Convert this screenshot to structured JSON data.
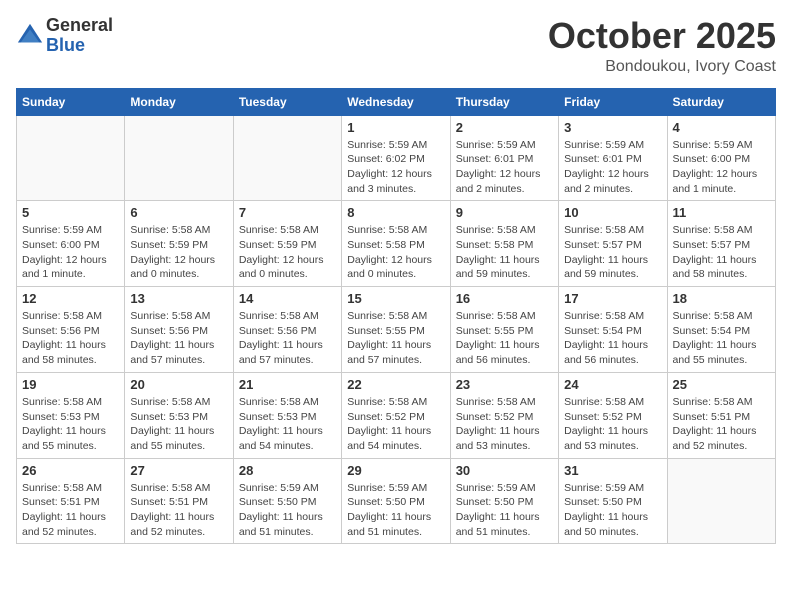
{
  "header": {
    "logo_general": "General",
    "logo_blue": "Blue",
    "month_title": "October 2025",
    "subtitle": "Bondoukou, Ivory Coast"
  },
  "days_of_week": [
    "Sunday",
    "Monday",
    "Tuesday",
    "Wednesday",
    "Thursday",
    "Friday",
    "Saturday"
  ],
  "weeks": [
    [
      {
        "day": "",
        "info": ""
      },
      {
        "day": "",
        "info": ""
      },
      {
        "day": "",
        "info": ""
      },
      {
        "day": "1",
        "info": "Sunrise: 5:59 AM\nSunset: 6:02 PM\nDaylight: 12 hours\nand 3 minutes."
      },
      {
        "day": "2",
        "info": "Sunrise: 5:59 AM\nSunset: 6:01 PM\nDaylight: 12 hours\nand 2 minutes."
      },
      {
        "day": "3",
        "info": "Sunrise: 5:59 AM\nSunset: 6:01 PM\nDaylight: 12 hours\nand 2 minutes."
      },
      {
        "day": "4",
        "info": "Sunrise: 5:59 AM\nSunset: 6:00 PM\nDaylight: 12 hours\nand 1 minute."
      }
    ],
    [
      {
        "day": "5",
        "info": "Sunrise: 5:59 AM\nSunset: 6:00 PM\nDaylight: 12 hours\nand 1 minute."
      },
      {
        "day": "6",
        "info": "Sunrise: 5:58 AM\nSunset: 5:59 PM\nDaylight: 12 hours\nand 0 minutes."
      },
      {
        "day": "7",
        "info": "Sunrise: 5:58 AM\nSunset: 5:59 PM\nDaylight: 12 hours\nand 0 minutes."
      },
      {
        "day": "8",
        "info": "Sunrise: 5:58 AM\nSunset: 5:58 PM\nDaylight: 12 hours\nand 0 minutes."
      },
      {
        "day": "9",
        "info": "Sunrise: 5:58 AM\nSunset: 5:58 PM\nDaylight: 11 hours\nand 59 minutes."
      },
      {
        "day": "10",
        "info": "Sunrise: 5:58 AM\nSunset: 5:57 PM\nDaylight: 11 hours\nand 59 minutes."
      },
      {
        "day": "11",
        "info": "Sunrise: 5:58 AM\nSunset: 5:57 PM\nDaylight: 11 hours\nand 58 minutes."
      }
    ],
    [
      {
        "day": "12",
        "info": "Sunrise: 5:58 AM\nSunset: 5:56 PM\nDaylight: 11 hours\nand 58 minutes."
      },
      {
        "day": "13",
        "info": "Sunrise: 5:58 AM\nSunset: 5:56 PM\nDaylight: 11 hours\nand 57 minutes."
      },
      {
        "day": "14",
        "info": "Sunrise: 5:58 AM\nSunset: 5:56 PM\nDaylight: 11 hours\nand 57 minutes."
      },
      {
        "day": "15",
        "info": "Sunrise: 5:58 AM\nSunset: 5:55 PM\nDaylight: 11 hours\nand 57 minutes."
      },
      {
        "day": "16",
        "info": "Sunrise: 5:58 AM\nSunset: 5:55 PM\nDaylight: 11 hours\nand 56 minutes."
      },
      {
        "day": "17",
        "info": "Sunrise: 5:58 AM\nSunset: 5:54 PM\nDaylight: 11 hours\nand 56 minutes."
      },
      {
        "day": "18",
        "info": "Sunrise: 5:58 AM\nSunset: 5:54 PM\nDaylight: 11 hours\nand 55 minutes."
      }
    ],
    [
      {
        "day": "19",
        "info": "Sunrise: 5:58 AM\nSunset: 5:53 PM\nDaylight: 11 hours\nand 55 minutes."
      },
      {
        "day": "20",
        "info": "Sunrise: 5:58 AM\nSunset: 5:53 PM\nDaylight: 11 hours\nand 55 minutes."
      },
      {
        "day": "21",
        "info": "Sunrise: 5:58 AM\nSunset: 5:53 PM\nDaylight: 11 hours\nand 54 minutes."
      },
      {
        "day": "22",
        "info": "Sunrise: 5:58 AM\nSunset: 5:52 PM\nDaylight: 11 hours\nand 54 minutes."
      },
      {
        "day": "23",
        "info": "Sunrise: 5:58 AM\nSunset: 5:52 PM\nDaylight: 11 hours\nand 53 minutes."
      },
      {
        "day": "24",
        "info": "Sunrise: 5:58 AM\nSunset: 5:52 PM\nDaylight: 11 hours\nand 53 minutes."
      },
      {
        "day": "25",
        "info": "Sunrise: 5:58 AM\nSunset: 5:51 PM\nDaylight: 11 hours\nand 52 minutes."
      }
    ],
    [
      {
        "day": "26",
        "info": "Sunrise: 5:58 AM\nSunset: 5:51 PM\nDaylight: 11 hours\nand 52 minutes."
      },
      {
        "day": "27",
        "info": "Sunrise: 5:58 AM\nSunset: 5:51 PM\nDaylight: 11 hours\nand 52 minutes."
      },
      {
        "day": "28",
        "info": "Sunrise: 5:59 AM\nSunset: 5:50 PM\nDaylight: 11 hours\nand 51 minutes."
      },
      {
        "day": "29",
        "info": "Sunrise: 5:59 AM\nSunset: 5:50 PM\nDaylight: 11 hours\nand 51 minutes."
      },
      {
        "day": "30",
        "info": "Sunrise: 5:59 AM\nSunset: 5:50 PM\nDaylight: 11 hours\nand 51 minutes."
      },
      {
        "day": "31",
        "info": "Sunrise: 5:59 AM\nSunset: 5:50 PM\nDaylight: 11 hours\nand 50 minutes."
      },
      {
        "day": "",
        "info": ""
      }
    ]
  ]
}
